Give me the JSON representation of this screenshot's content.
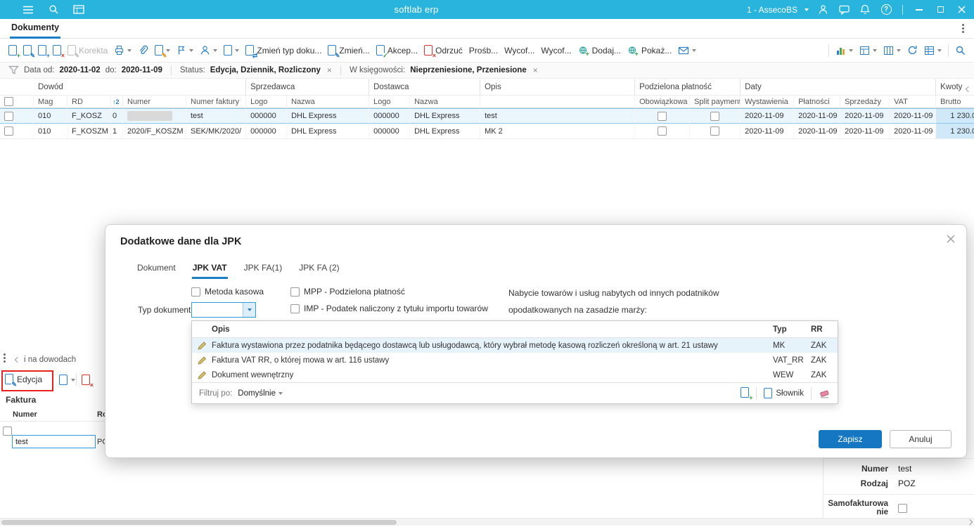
{
  "topbar": {
    "title": "softlab erp",
    "company": "1 - AssecoBS"
  },
  "tabbar": {
    "active_tab": "Dokumenty"
  },
  "toolbar": {
    "korekta": "Korekta",
    "zmien_typ": "Zmień typ doku...",
    "zmien": "Zmień...",
    "akcep": "Akcep...",
    "odrzuc": "Odrzuć",
    "prosb": "Prośb...",
    "wycof1": "Wycof...",
    "wycof2": "Wycof...",
    "dodaj": "Dodaj...",
    "pokaz": "Pokaż..."
  },
  "filterbar": {
    "data_label": "Data od:",
    "data_from": "2020-11-02",
    "do_label": "do:",
    "data_to": "2020-11-09",
    "status_label": "Status:",
    "status_value": "Edycja, Dziennik, Rozliczony",
    "ksieg_label": "W księgowości:",
    "ksieg_value": "Nieprzeniesione, Przeniesione"
  },
  "grid": {
    "sort_indicator": "↑2",
    "groups": {
      "dowod": "Dowód",
      "sprzedawca": "Sprzedawca",
      "dostawca": "Dostawca",
      "opis": "Opis",
      "podzielona": "Podzielona płatność",
      "daty": "Daty",
      "kwoty": "Kwoty"
    },
    "columns": {
      "mag": "Mag",
      "rd": "RD",
      "numer": "Numer",
      "numer_faktury": "Numer faktury",
      "logo1": "Logo",
      "nazwa1": "Nazwa",
      "logo2": "Logo",
      "nazwa2": "Nazwa",
      "obowiazkowa": "Obowiązkowa",
      "split": "Split payment",
      "wystawienia": "Wystawienia",
      "platnosci": "Płatności",
      "sprzedazy": "Sprzedaży",
      "vat": "VAT",
      "brutto": "Brutto"
    },
    "rows": [
      {
        "mag": "010",
        "rd": "F_KOSZ",
        "lp": "0",
        "numer_faktury": "test",
        "logo1": "000000",
        "nazwa1": "DHL Express",
        "logo2": "000000",
        "nazwa2": "DHL Express",
        "opis": "test",
        "wystawienia": "2020-11-09",
        "platnosci": "2020-11-09",
        "sprzedazy": "2020-11-09",
        "vat": "2020-11-09",
        "brutto": "1 230.0"
      },
      {
        "mag": "010",
        "rd": "F_KOSZM",
        "lp": "1",
        "numer": "2020/F_KOSZM",
        "numer_faktury": "SEK/MK/2020/",
        "logo1": "000000",
        "nazwa1": "DHL Express",
        "logo2": "000000",
        "nazwa2": "DHL Express",
        "opis": "MK 2",
        "wystawienia": "2020-11-09",
        "platnosci": "2020-11-09",
        "sprzedazy": "2020-11-09",
        "vat": "2020-11-09",
        "brutto": "1 230.0"
      }
    ]
  },
  "modal": {
    "title": "Dodatkowe dane dla JPK",
    "tabs": {
      "dokument": "Dokument",
      "jpk_vat": "JPK VAT",
      "jpk_fa1": "JPK FA(1)",
      "jpk_fa2": "JPK FA (2)"
    },
    "metoda_kasowa": "Metoda kasowa",
    "mpp": "MPP - Podzielona płatność",
    "nabycie_text": "Nabycie towarów i usług nabytych od innych podatników",
    "typ_dokumentu_label": "Typ dokumentu",
    "imp": "IMP - Podatek naliczony z tytułu importu towarów",
    "marza_text": "opodatkowanych na zasadzie marży:",
    "dropdown": {
      "col_opis": "Opis",
      "col_typ": "Typ",
      "col_rr": "RR",
      "rows": [
        {
          "opis": "Faktura wystawiona przez podatnika będącego dostawcą lub usługodawcą, który wybrał metodę kasową rozliczeń określoną w art. 21 ustawy",
          "typ": "MK",
          "rr": "ZAK"
        },
        {
          "opis": "Faktura VAT RR, o której mowa w art. 116 ustawy",
          "typ": "VAT_RR",
          "rr": "ZAK"
        },
        {
          "opis": "Dokument wewnętrzny",
          "typ": "WEW",
          "rr": "ZAK"
        }
      ],
      "filtruj_label": "Filtruj po:",
      "filtruj_value": "Domyślnie",
      "slownik_label": "Słownik"
    },
    "save_label": "Zapisz",
    "cancel_label": "Anuluj"
  },
  "left_panel": {
    "header_text": "i na dowodach",
    "edycja": "Edycja",
    "faktura": "Faktura",
    "col_numer": "Numer",
    "col_rodzaj": "Rodzaj",
    "numer_value": "test",
    "rodzaj_value": "POZ"
  },
  "right_panel": {
    "numer_label": "Numer",
    "numer_value": "test",
    "rodzaj_label": "Rodzaj",
    "rodzaj_value": "POZ",
    "samofakturowanie_label": "Samofakturowanie"
  },
  "colors": {
    "topbar": "#28b4dd",
    "accent": "#1577c2",
    "annotation": "#e8221e",
    "selection": "#cfe9f8"
  }
}
